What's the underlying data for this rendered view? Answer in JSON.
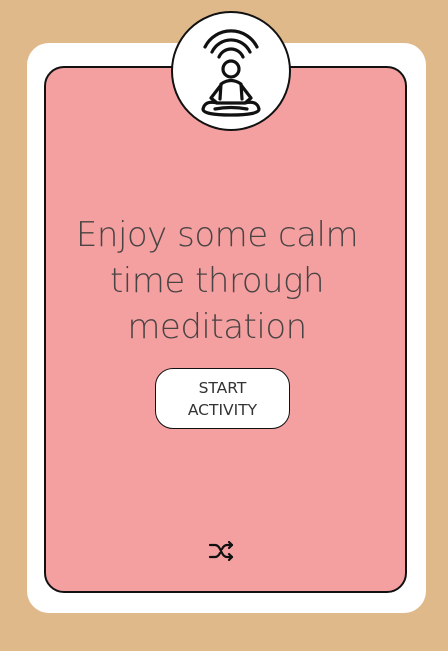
{
  "card": {
    "headline": "Enjoy some calm\ntime through\nmeditation",
    "start_button_label": "START\nACTIVITY"
  },
  "icons": {
    "badge": "meditation-signal-icon",
    "shuffle": "shuffle-icon"
  },
  "colors": {
    "background": "#dfb98a",
    "card_outer": "#ffffff",
    "card_inner": "#f4a0a0",
    "text": "#4a4343",
    "border": "#111111"
  }
}
